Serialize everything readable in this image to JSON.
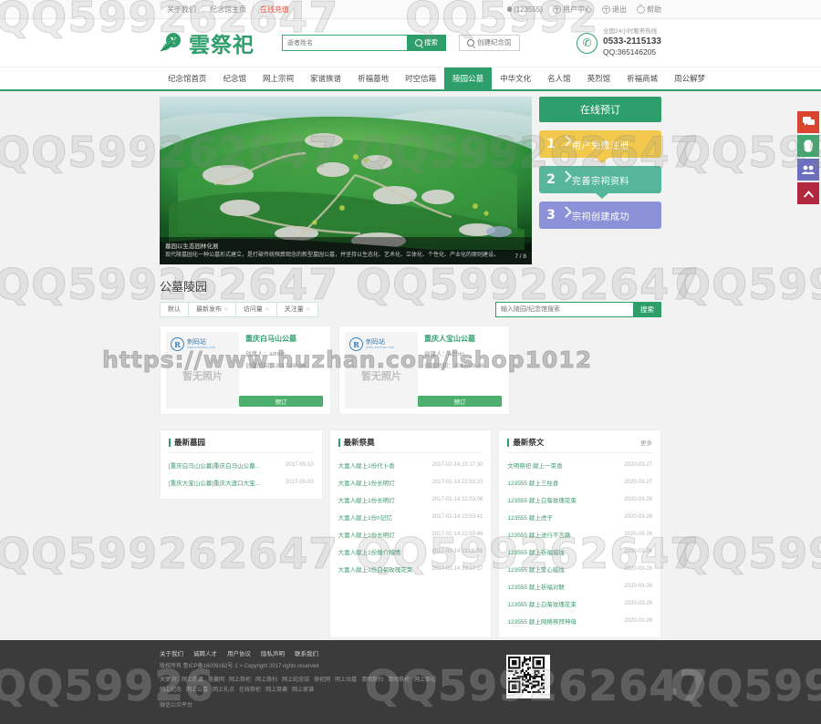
{
  "topbar": {
    "left_links": [
      "关于我们",
      "纪念馆主页",
      "在线充值"
    ],
    "hot_index": 2,
    "user_id": "(123555)",
    "user_center": "用户中心",
    "logout": "退出",
    "help": "帮助"
  },
  "header": {
    "logo_text": "雲祭祀",
    "search_placeholder": "逝者姓名",
    "search_button": "搜索",
    "create_button": "创建纪念馆",
    "service_line": "全国24小时服务热线",
    "phone": "0533-2115133",
    "qq": "QQ:365146205"
  },
  "nav": {
    "items": [
      {
        "label": "纪念馆首页",
        "active": false
      },
      {
        "label": "纪念馆",
        "active": false
      },
      {
        "label": "网上宗祠",
        "active": false
      },
      {
        "label": "家谱族谱",
        "active": false
      },
      {
        "label": "祈福墓地",
        "active": false
      },
      {
        "label": "时空信箱",
        "active": false
      },
      {
        "label": "陵园公墓",
        "active": true
      },
      {
        "label": "中华文化",
        "active": false
      },
      {
        "label": "名人馆",
        "active": false
      },
      {
        "label": "英烈馆",
        "active": false
      },
      {
        "label": "祈福商城",
        "active": false
      },
      {
        "label": "周公解梦",
        "active": false
      }
    ]
  },
  "banner": {
    "caption_title": "墓园以生态园林化展",
    "caption_desc": "现代陵墓园化一种公墓形式建立，是打破传统殡葬观念的新型墓园公墓，并坚持以生态化、艺术化、立体化、个性化、产业化的原则建设。",
    "page_indicator": "7 / 8"
  },
  "sidepanel": {
    "order_button": "在线预订",
    "steps": [
      {
        "num": "1",
        "label": "用户免费注册",
        "color": "#f2c94c"
      },
      {
        "num": "2",
        "label": "完善宗祠资料",
        "color": "#56b69c"
      },
      {
        "num": "3",
        "label": "宗祠创建成功",
        "color": "#8d92d8"
      }
    ]
  },
  "section": {
    "title": "公墓陵园",
    "tabs": [
      "默认",
      "最新发布",
      "访问量",
      "关注量"
    ],
    "search_placeholder": "输入陵园/纪念馆搜索",
    "search_button": "搜索"
  },
  "cards": [
    {
      "brand_mark": "R",
      "brand_name": "刺码站",
      "brand_sub": "www.cmcbao.com",
      "no_image": "暂无照片",
      "title": "重庆白马山公墓",
      "creator_label": "创建人：admin",
      "time_label": "创建时间：2017-08-08",
      "button": "预订"
    },
    {
      "brand_mark": "R",
      "brand_name": "刺码站",
      "brand_sub": "www.cmcbao.com",
      "no_image": "暂无照片",
      "title": "重庆人宝山公墓",
      "creator_label": "创建人：admin",
      "time_label": "创建时间：2017-08-08",
      "button": "预订"
    }
  ],
  "panels": [
    {
      "title": "最新墓园",
      "more": "",
      "items": [
        {
          "text": "[重庆白马山公墓]重庆白马山公墓...",
          "date": "2017-05-10"
        },
        {
          "text": "[重庆大宝山公墓]重庆大渡口大宝...",
          "date": "2017-05-03"
        }
      ]
    },
    {
      "title": "最新祭奠",
      "more": "",
      "items": [
        {
          "text": "大富人献上1份代卜香",
          "date": "2017-02-14 23:17:30"
        },
        {
          "text": "大富人献上1份长明灯",
          "date": "2017-02-14 22:53:20"
        },
        {
          "text": "大富人献上1份长明灯",
          "date": "2017-02-14 22:53:06"
        },
        {
          "text": "大富人献上1份h记忆",
          "date": "2017-02-14 22:53:41"
        },
        {
          "text": "大富人献上1份长明灯",
          "date": "2017-02-14 22:53:46"
        },
        {
          "text": "大富人献上1份婚介稽情",
          "date": "2017-02-14 23:06:56"
        },
        {
          "text": "大富人献上1份白菊玫瑰花束",
          "date": "2017-02-14 23:17:17"
        }
      ]
    },
    {
      "title": "最新祭文",
      "more": "更多",
      "items": [
        {
          "text": "文明祭祀 献上一束香",
          "date": "2020-03-27"
        },
        {
          "text": "123555 献上三柱香",
          "date": "2020-03-27"
        },
        {
          "text": "123555 献上白菊玫瑰花束",
          "date": "2020-03-26"
        },
        {
          "text": "123555 献上虎子",
          "date": "2020-03-26"
        },
        {
          "text": "123555 献上送行不言路",
          "date": "2020-03-26"
        },
        {
          "text": "123555 献上祈福蜡烛",
          "date": "2020-03-26"
        },
        {
          "text": "123555 献上爱心蜡烛",
          "date": "2020-03-26"
        },
        {
          "text": "123555 献上祈福对联",
          "date": "2020-03-26"
        },
        {
          "text": "123555 献上白菊玫瑰花束",
          "date": "2020-03-26"
        },
        {
          "text": "123555 献上网络祭拜神母",
          "date": "2020-03-26"
        }
      ]
    }
  ],
  "footer": {
    "links": [
      "关于我们",
      "诚聘人才",
      "用户协议",
      "隐私声明",
      "联系我们"
    ],
    "copyright": "版权所有 鲁ICP备16009162号-1 > Copyright 2017 rights reserved",
    "keywords_label": "关键词：",
    "keywords": [
      "网上祭奠",
      "祭奠网",
      "网上祭祀",
      "网上祭扫",
      "网上纪念馆",
      "祭祀网",
      "网上坟墓",
      "清明祭扫",
      "清明祭祀",
      "网上祭祖"
    ],
    "keywords2": [
      "网上纪念",
      "网上公墓",
      "网上礼点",
      "在线祭祀",
      "网上祭奠",
      "网上家谱"
    ],
    "wechat": "微信公众平台"
  },
  "float_buttons": [
    {
      "name": "chat-icon",
      "color": "#d9452f"
    },
    {
      "name": "qq-icon",
      "color": "#3fa86c"
    },
    {
      "name": "users-icon",
      "color": "#6b6fbe"
    },
    {
      "name": "scroll-top-icon",
      "color": "#b3273f"
    }
  ]
}
